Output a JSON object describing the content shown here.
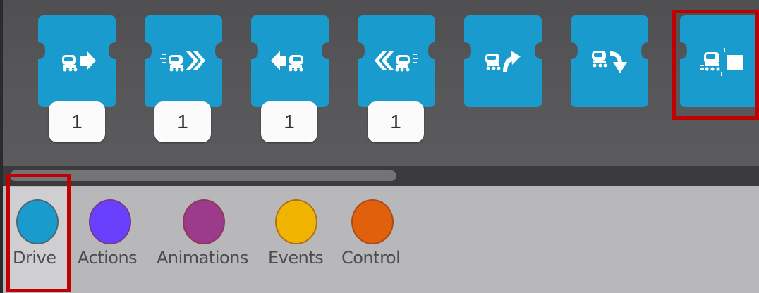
{
  "palette": {
    "block_color": "#1a9bcd",
    "blocks": [
      {
        "name": "drive-forward-block",
        "icon": "drive-forward-icon",
        "value": "1"
      },
      {
        "name": "drive-forward-fast-block",
        "icon": "drive-forward-fast-icon",
        "value": "1"
      },
      {
        "name": "drive-backward-block",
        "icon": "drive-backward-icon",
        "value": "1"
      },
      {
        "name": "drive-backward-fast-block",
        "icon": "drive-backward-fast-icon",
        "value": "1"
      },
      {
        "name": "turn-left-block",
        "icon": "turn-left-icon"
      },
      {
        "name": "turn-right-block",
        "icon": "turn-right-icon"
      },
      {
        "name": "bump-block",
        "icon": "bump-icon"
      }
    ]
  },
  "categories": [
    {
      "label": "Drive",
      "color": "#1a9bcd",
      "selected": true
    },
    {
      "label": "Actions",
      "color": "#6a40ff"
    },
    {
      "label": "Animations",
      "color": "#9c3a8c"
    },
    {
      "label": "Events",
      "color": "#f0b400"
    },
    {
      "label": "Control",
      "color": "#e0600c"
    }
  ],
  "highlight_color": "#c00000"
}
